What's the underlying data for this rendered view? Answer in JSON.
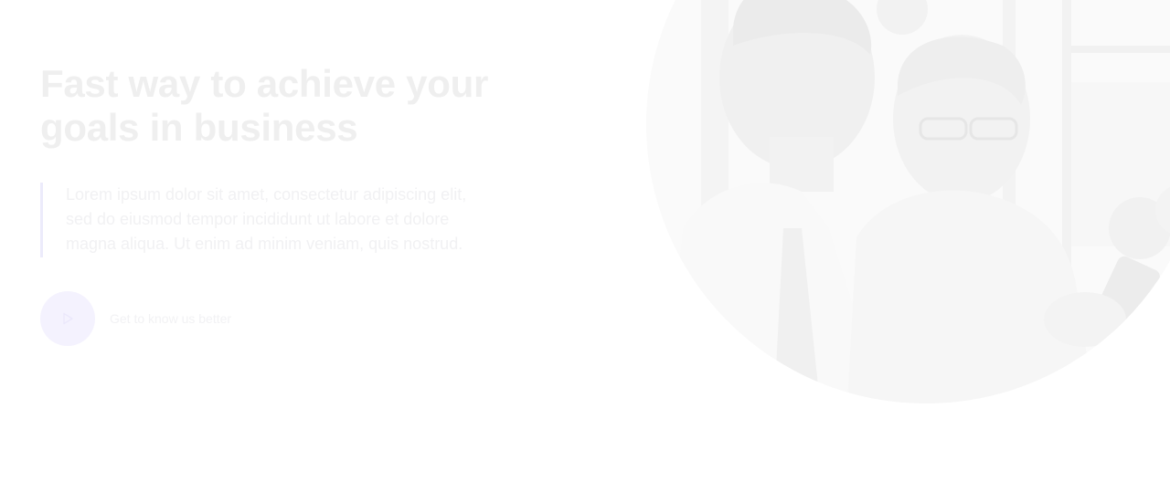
{
  "hero": {
    "title_line1": "Fast way to achieve your",
    "title_line2": "goals in business",
    "quote_line1": "Lorem ipsum dolor sit amet, consectetur adipiscing elit,",
    "quote_line2": "sed do eiusmod tempor incididunt ut labore et dolore",
    "quote_line3": "magna aliqua. Ut enim ad minim veniam, quis nostrud.",
    "cta_label": "Get to know us better",
    "cta_icon": "play-icon"
  },
  "photo": {
    "subject": "two-businessmen-looking-at-phone"
  },
  "colors": {
    "title": "#efefef",
    "quote_border": "#ecebfb",
    "play_button_bg": "#f4f2fe"
  }
}
